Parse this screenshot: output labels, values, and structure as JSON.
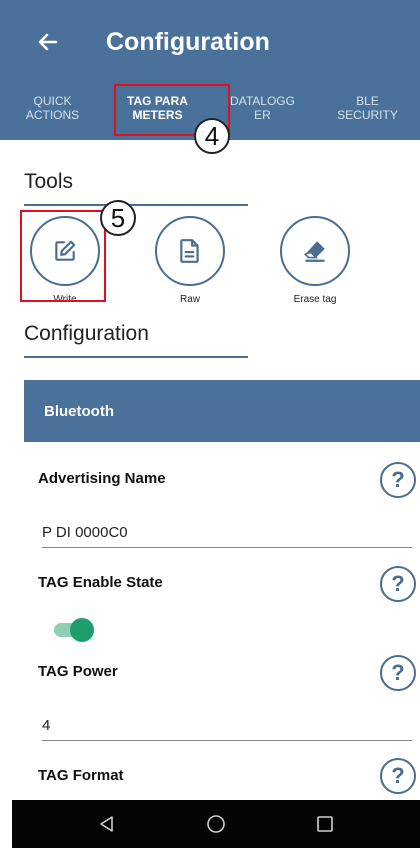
{
  "header": {
    "title": "Configuration",
    "back_icon": "arrow-left-icon"
  },
  "tabs": [
    {
      "label": "QUICK\nACTIONS",
      "active": false
    },
    {
      "label": "TAG PARA\nMETERS",
      "active": true
    },
    {
      "label": "DATALOGG\nER",
      "active": false
    },
    {
      "label": "BLE\nSECURITY",
      "active": false
    }
  ],
  "annotations": {
    "callout_4": "4",
    "callout_5": "5"
  },
  "tools": {
    "title": "Tools",
    "items": [
      {
        "label": "Write",
        "icon": "edit-icon"
      },
      {
        "label": "Raw",
        "icon": "document-icon"
      },
      {
        "label": "Erase tag",
        "icon": "eraser-icon"
      }
    ]
  },
  "configuration": {
    "title": "Configuration",
    "bluetooth": {
      "header": "Bluetooth",
      "advertising_name_label": "Advertising Name",
      "advertising_name_value": "P DI 0000C0",
      "tag_enable_state_label": "TAG Enable State",
      "tag_enable_state_on": true,
      "tag_power_label": "TAG Power",
      "tag_power_value": "4",
      "tag_format_label": "TAG Format"
    },
    "help_glyph": "?"
  },
  "colors": {
    "primary": "#4a7199",
    "accent_green": "#1e9e6a",
    "annotation_red": "#e01020"
  },
  "navbar": {
    "back_icon": "nav-back-icon",
    "home_icon": "nav-home-icon",
    "recents_icon": "nav-recents-icon"
  }
}
